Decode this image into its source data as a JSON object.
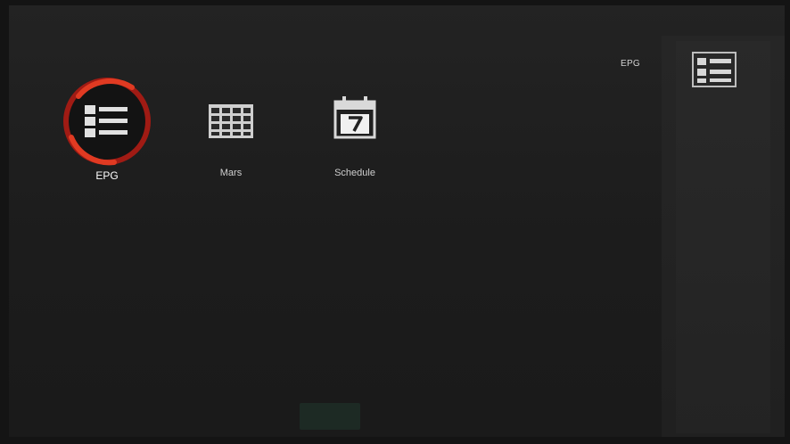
{
  "header": {
    "title": "EPG",
    "icon": "epg-list-icon"
  },
  "menu": {
    "items": [
      {
        "label": "EPG",
        "icon": "epg-list-icon",
        "selected": true
      },
      {
        "label": "Mars",
        "icon": "grid-table-icon",
        "selected": false
      },
      {
        "label": "Schedule",
        "icon": "calendar-icon",
        "selected": false
      }
    ]
  },
  "colors": {
    "background": "#141414",
    "panel": "#1f1f1f",
    "focus_ring": "#d42a1e",
    "text": "#cfcfcf"
  }
}
